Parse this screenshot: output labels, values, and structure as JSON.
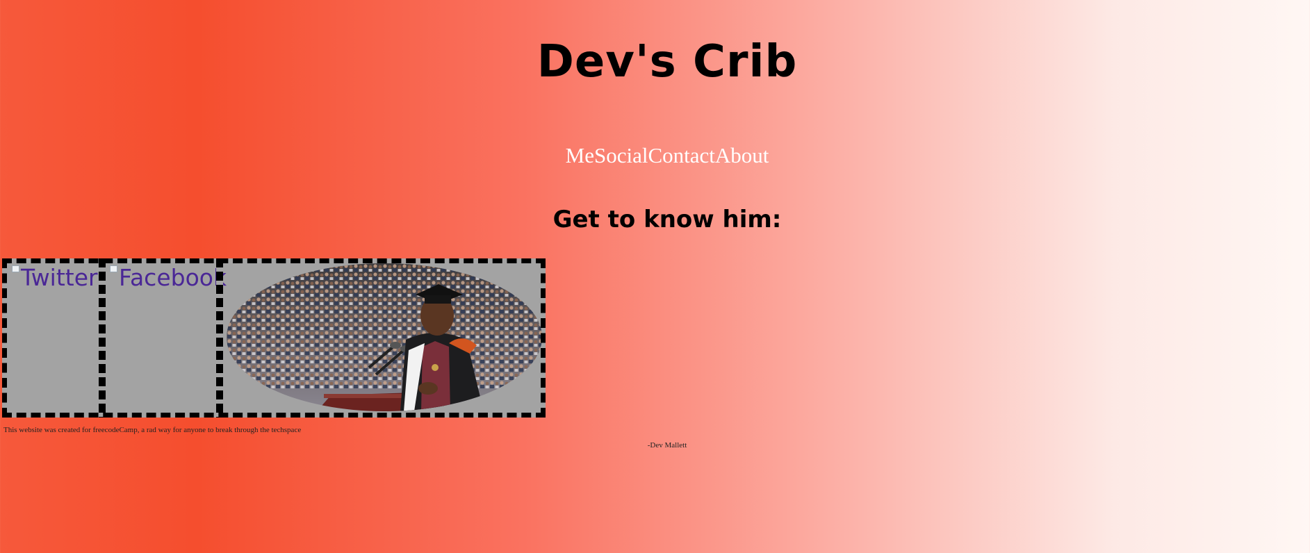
{
  "header": {
    "title": "Dev's Crib"
  },
  "nav": {
    "items": [
      {
        "label": "Me"
      },
      {
        "label": "Social"
      },
      {
        "label": "Contact"
      },
      {
        "label": "About"
      }
    ]
  },
  "section": {
    "heading": "Get to know him:"
  },
  "gallery": {
    "twitter_alt": "Twitter",
    "facebook_alt": "Facebook",
    "photo_description": "graduation speaker photo"
  },
  "footer": {
    "caption": "This website was created for freecodeCamp, a rad way for anyone to break through the techspace",
    "signature": "-Dev Mallett"
  },
  "colors": {
    "gradient_start": "#f54e2e",
    "gradient_end": "#fff7f4",
    "nav_text": "#ffffff",
    "link_alt_text": "#4a2796",
    "gallery_bg": "#a3a3a3"
  }
}
